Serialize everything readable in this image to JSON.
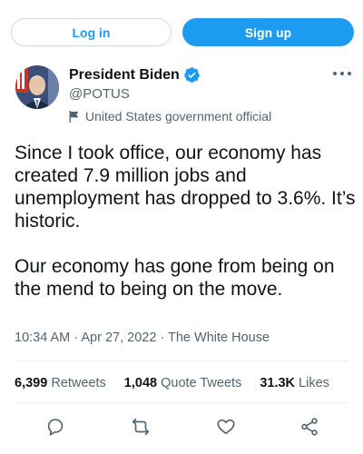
{
  "header": {
    "login_label": "Log in",
    "signup_label": "Sign up"
  },
  "author": {
    "name": "President Biden",
    "handle": "@POTUS",
    "label": "United States government official",
    "verified": true
  },
  "tweet": {
    "paragraphs": [
      "Since I took office, our economy has created 7.9 million jobs and unemployment has dropped to 3.6%. It’s historic.",
      "Our economy has gone from being on the mend to being on the move."
    ],
    "meta": "10:34 AM · Apr 27, 2022 · The White House"
  },
  "stats": {
    "retweets": {
      "count": "6,399",
      "label": "Retweets"
    },
    "quotes": {
      "count": "1,048",
      "label": "Quote Tweets"
    },
    "likes": {
      "count": "31.3K",
      "label": "Likes"
    }
  },
  "actions": [
    "reply-icon",
    "retweet-icon",
    "like-icon",
    "share-icon"
  ],
  "colors": {
    "accent": "#1d9bf0",
    "text": "#0f1419",
    "secondary": "#536471",
    "border": "#cfd9de"
  }
}
